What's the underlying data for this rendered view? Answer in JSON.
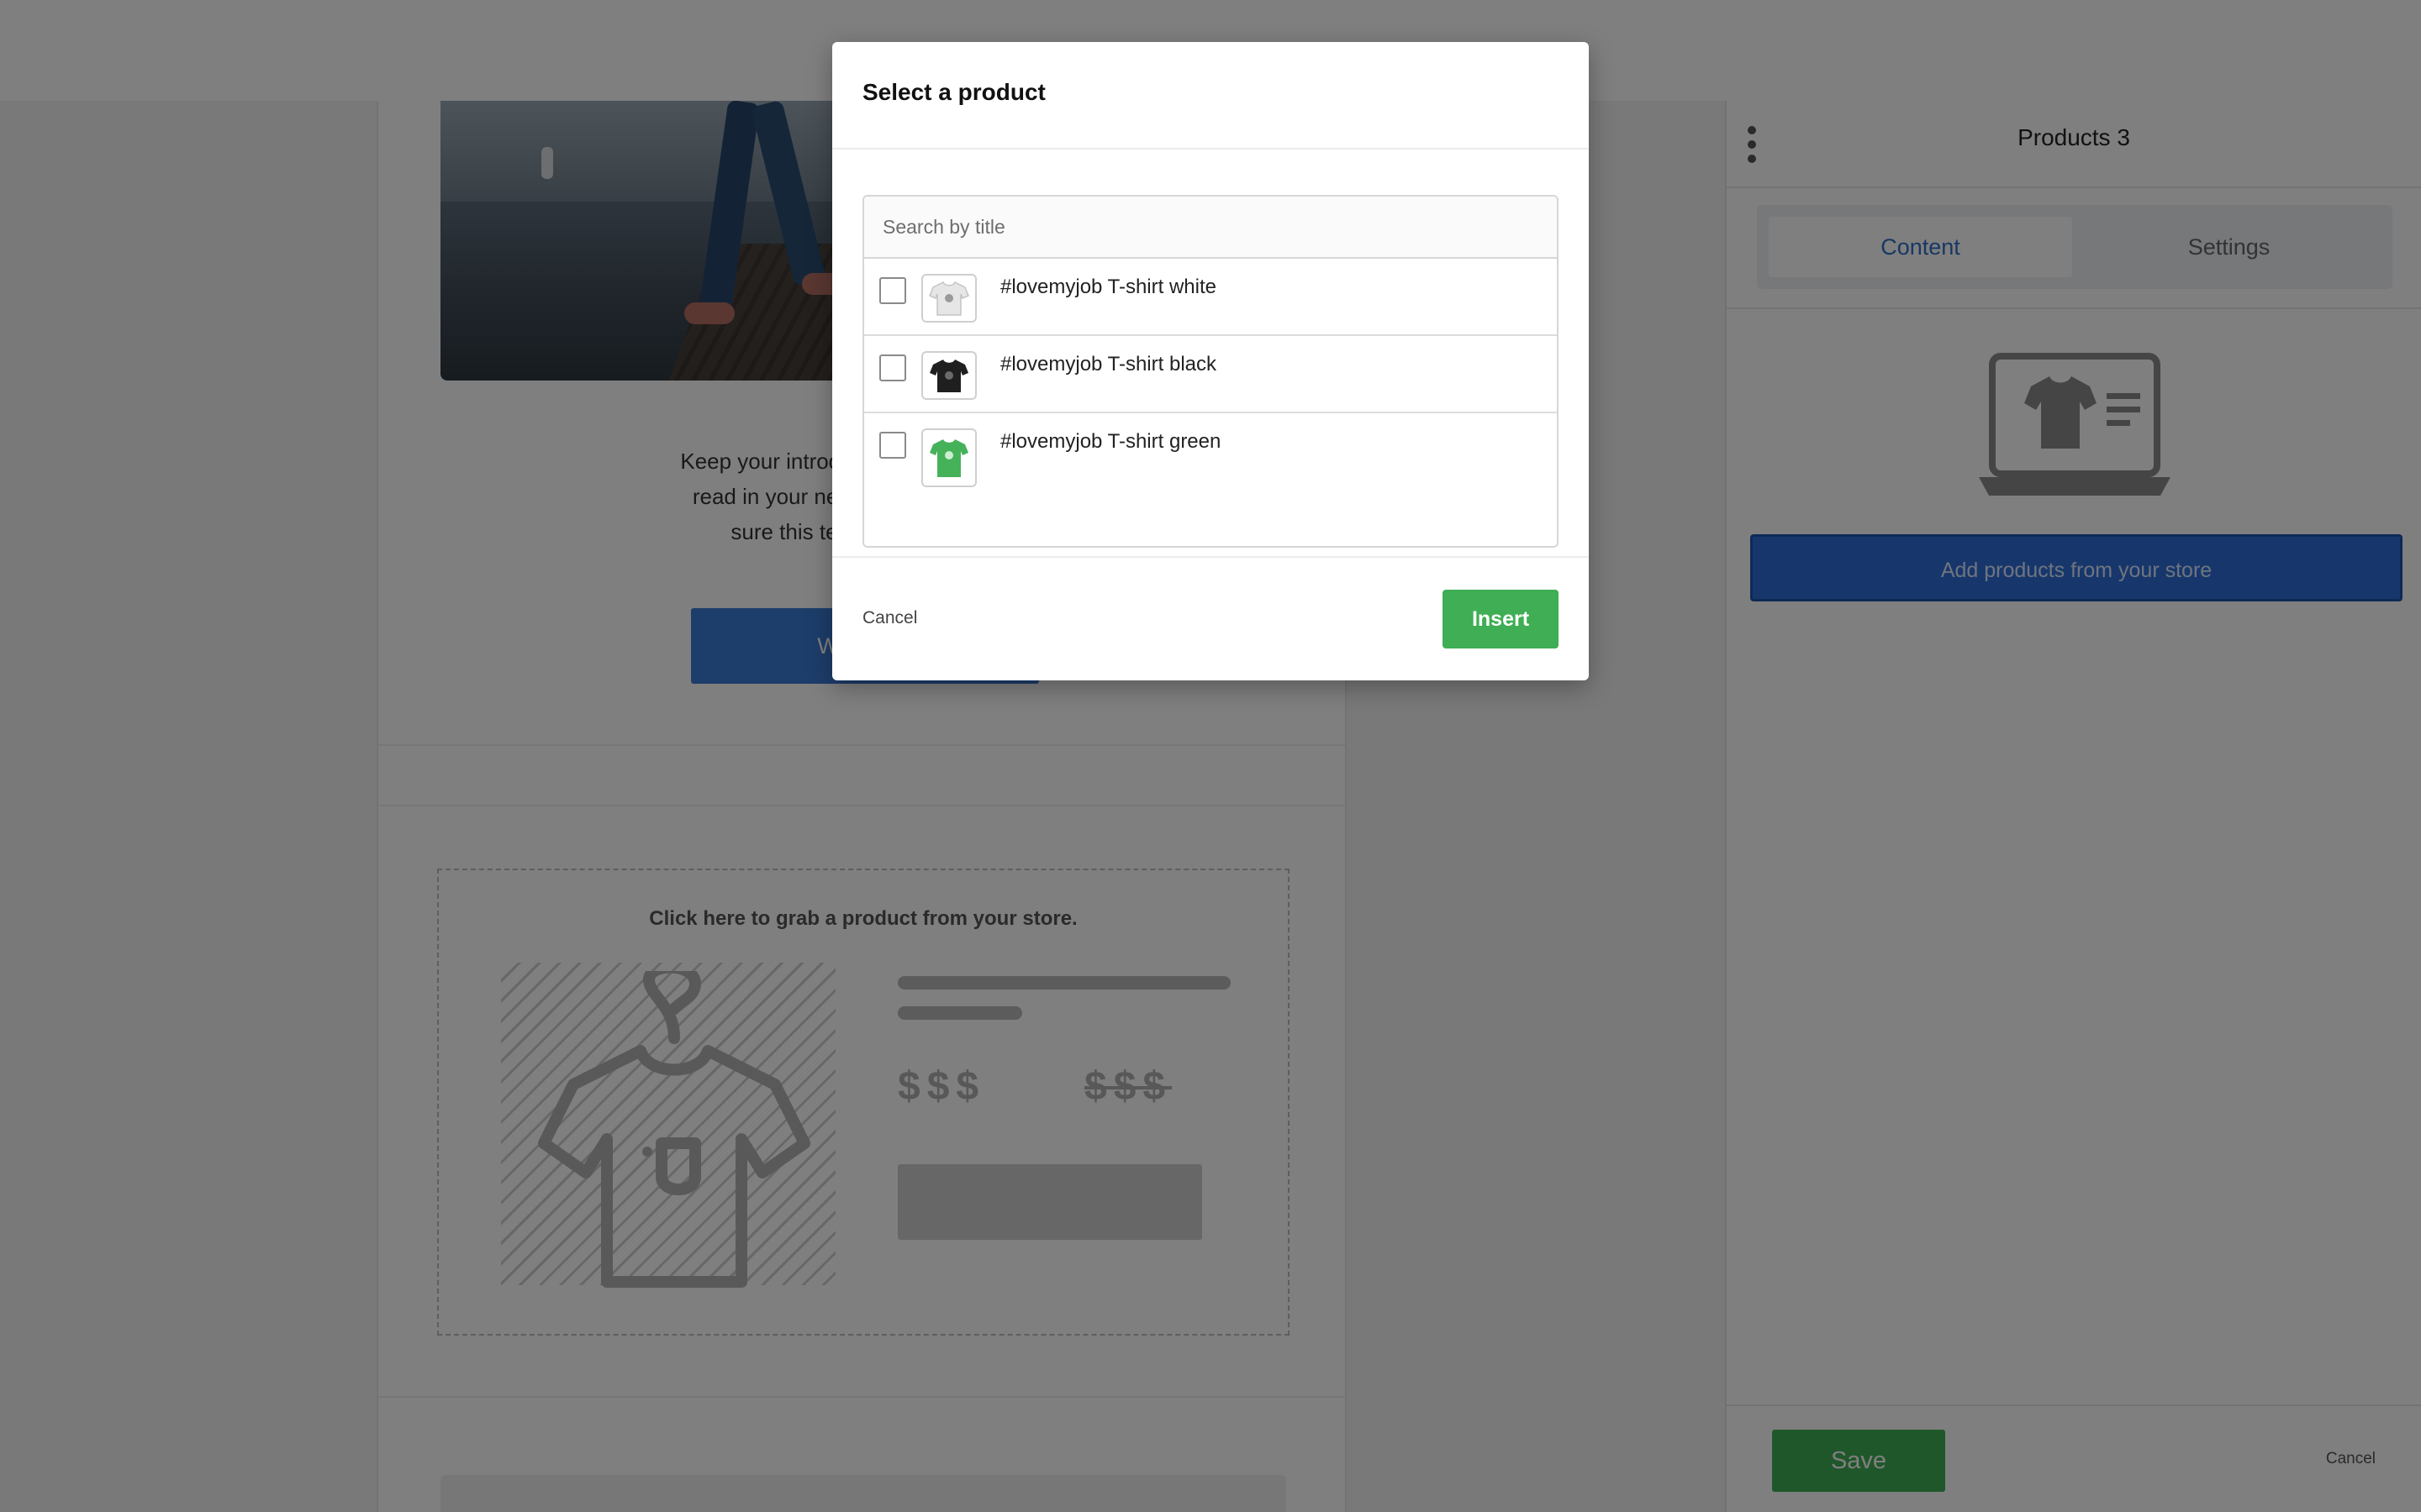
{
  "email": {
    "intro_text": "Keep your introduction short and sweet. Highlight what customers will read in your newsletter (for example, ... Make sure this text motivates the ...",
    "intro_lines": [
      "Keep your introduction short and swe",
      "read in your newsletter (for exampl",
      "sure this text motivates the"
    ],
    "cta_label": "Write a st",
    "product_placeholder": {
      "title": "Click here to grab a product from your store.",
      "price": "$$$",
      "old_price": "$$$"
    }
  },
  "panel": {
    "title": "Products 3",
    "tabs": [
      {
        "label": "Content",
        "active": true
      },
      {
        "label": "Settings",
        "active": false
      }
    ],
    "add_products_label": "Add products from your store",
    "save_label": "Save",
    "cancel_label": "Cancel",
    "illustration_icon": "laptop-tshirt-icon"
  },
  "modal": {
    "title": "Select a product",
    "search_placeholder": "Search by title",
    "products": [
      {
        "label": "#lovemyjob T-shirt white",
        "checked": false,
        "shirt_color": "#e6e6e6"
      },
      {
        "label": "#lovemyjob T-shirt black",
        "checked": false,
        "shirt_color": "#1f1f1f"
      },
      {
        "label": "#lovemyjob T-shirt green",
        "checked": false,
        "shirt_color": "#45b25a"
      }
    ],
    "cancel_label": "Cancel",
    "insert_label": "Insert"
  },
  "colors": {
    "accent_blue": "#2f6fd8",
    "success_green": "#3fae54",
    "overlay": "rgba(0,0,0,0.5)"
  }
}
